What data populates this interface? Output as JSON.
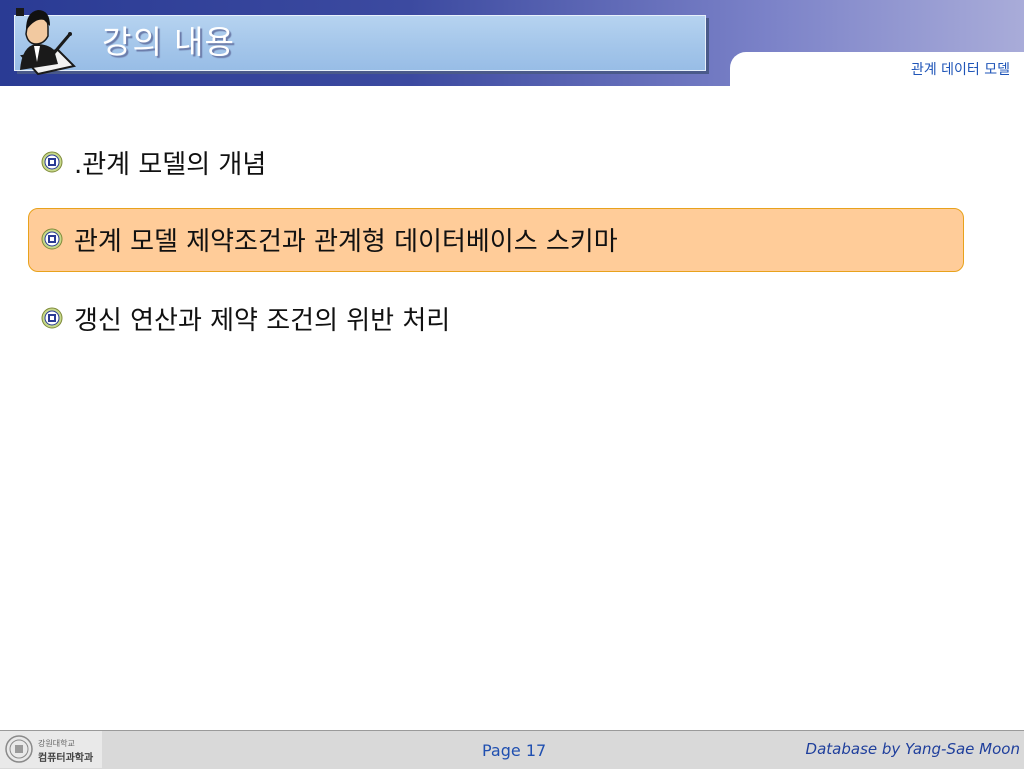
{
  "header": {
    "title": "강의 내용",
    "subtitle": "관계 데이터 모델"
  },
  "bullets": [
    {
      "text": ".관계 모델의 개념",
      "highlighted": false
    },
    {
      "text": "관계 모델 제약조건과 관계형 데이터베이스 스키마",
      "highlighted": true
    },
    {
      "text": "갱신 연산과 제약 조건의 위반 처리",
      "highlighted": false
    }
  ],
  "footer": {
    "logo_top": "강원대학교",
    "logo_bottom": "컴퓨터과학과",
    "page": "Page 17",
    "credit": "Database by Yang-Sae Moon"
  },
  "colors": {
    "header_dark": "#2a3b94",
    "highlight_fill": "#ffcc99",
    "highlight_border": "#e8a21c",
    "subtitle": "#1f55b8"
  },
  "icons": {
    "presenter": "presenter-with-pen-icon",
    "bullet": "university-emblem-icon"
  }
}
